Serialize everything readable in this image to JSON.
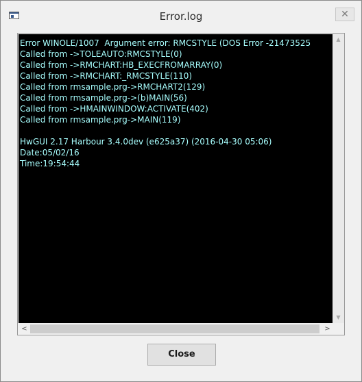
{
  "window": {
    "title": "Error.log",
    "close_glyph": "✕"
  },
  "log": {
    "lines": [
      "Error WINOLE/1007  Argument error: RMCSTYLE (DOS Error -21473525",
      "Called from ->TOLEAUTO:RMCSTYLE(0)",
      "Called from ->RMCHART:HB_EXECFROMARRAY(0)",
      "Called from ->RMCHART:_RMCSTYLE(110)",
      "Called from rmsample.prg->RMCHART2(129)",
      "Called from rmsample.prg->(b)MAIN(56)",
      "Called from ->HMAINWINDOW:ACTIVATE(402)",
      "Called from rmsample.prg->MAIN(119)",
      "",
      "HwGUI 2.17 Harbour 3.4.0dev (e625a37) (2016-04-30 05:06)",
      "Date:05/02/16",
      "Time:19:54:44"
    ]
  },
  "scrollbars": {
    "up_arrow": "▲",
    "down_arrow": "▼",
    "left_arrow": "<",
    "right_arrow": ">"
  },
  "buttons": {
    "close_label": "Close"
  },
  "colors": {
    "log_background": "#000000",
    "log_text": "#a8ffff"
  },
  "icons": {
    "app": "window-app-icon",
    "close": "close-icon"
  }
}
